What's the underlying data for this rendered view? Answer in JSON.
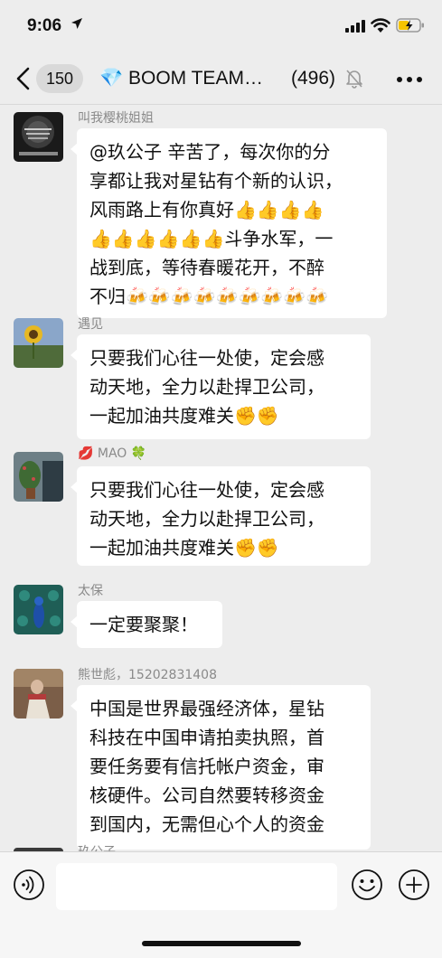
{
  "status_bar": {
    "time": "9:06"
  },
  "nav": {
    "unread_count": "150",
    "title": "💎 BOOM TEAM…",
    "member_count": "(496)"
  },
  "messages": [
    {
      "sender": "叫我樱桃姐姐",
      "text": "@玖公子 辛苦了，每次你的分\n享都让我对星钻有个新的认识，\n风雨路上有你真好👍👍👍👍\n👍👍👍👍👍👍斗争水军，一\n战到底，等待春暖花开，不醉\n不归🍻🍻🍻🍻🍻🍻🍻🍻🍻",
      "avatar_label": "avatar-dark-text-image"
    },
    {
      "sender": "遇见",
      "text": "只要我们心往一处使，定会感\n动天地，全力以赴捍卫公司，\n一起加油共度难关✊✊",
      "avatar_label": "avatar-sunflower"
    },
    {
      "sender": "💋 MAO 🍀",
      "text": "只要我们心往一处使，定会感\n动天地，全力以赴捍卫公司，\n一起加油共度难关✊✊",
      "avatar_label": "avatar-plant"
    },
    {
      "sender": "太保",
      "text": "一定要聚聚！",
      "avatar_label": "avatar-peacock"
    },
    {
      "sender": "熊世彪，15202831408",
      "text": "中国是世界最强经济体，星钻\n科技在中国申请拍卖执照，首\n要任务要有信托帐户资金，审\n核硬件。公司自然要转移资金\n到国内，无需但心个人的资金",
      "avatar_label": "avatar-painting"
    }
  ],
  "partial_sender": "玖公子",
  "colors": {
    "background": "#ededed",
    "bubble": "#ffffff",
    "sender_name": "#8a8a8a"
  }
}
